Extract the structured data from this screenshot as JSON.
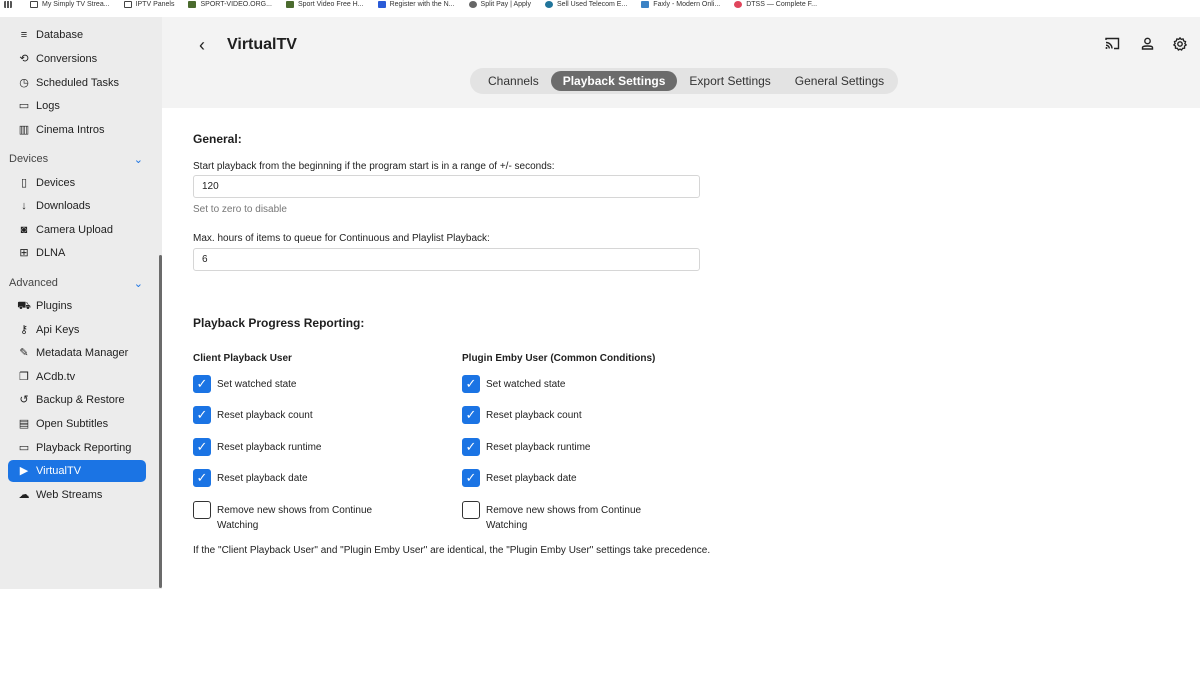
{
  "bookmarks": [
    {
      "label": "My Simply TV Strea...",
      "icon": "folder-icon"
    },
    {
      "label": "IPTV Panels",
      "icon": "folder-icon"
    },
    {
      "label": "SPORT-VIDEO.ORG...",
      "icon": "image-icon"
    },
    {
      "label": "Sport Video Free H...",
      "icon": "image-icon"
    },
    {
      "label": "Register with the N...",
      "icon": "blue-square-icon"
    },
    {
      "label": "Split Pay | Apply",
      "icon": "ball-icon"
    },
    {
      "label": "Sell Used Telecom E...",
      "icon": "wordpress-icon"
    },
    {
      "label": "Faxly - Modern Onli...",
      "icon": "fax-icon"
    },
    {
      "label": "DTSS — Complete F...",
      "icon": "red-dot-icon"
    }
  ],
  "sidebar": {
    "items_top": [
      {
        "label": "Database",
        "icon": "database-icon",
        "glyph": "≡"
      },
      {
        "label": "Conversions",
        "icon": "conversions-icon",
        "glyph": "⟲"
      },
      {
        "label": "Scheduled Tasks",
        "icon": "clock-icon",
        "glyph": "◷"
      },
      {
        "label": "Logs",
        "icon": "folder-open-icon",
        "glyph": "▭"
      },
      {
        "label": "Cinema Intros",
        "icon": "film-icon",
        "glyph": "▥"
      }
    ],
    "section_devices": "Devices",
    "items_devices": [
      {
        "label": "Devices",
        "icon": "devices-icon",
        "glyph": "▯"
      },
      {
        "label": "Downloads",
        "icon": "download-icon",
        "glyph": "↓"
      },
      {
        "label": "Camera Upload",
        "icon": "camera-icon",
        "glyph": "◙"
      },
      {
        "label": "DLNA",
        "icon": "dlna-icon",
        "glyph": "⊞"
      }
    ],
    "section_advanced": "Advanced",
    "items_advanced": [
      {
        "label": "Plugins",
        "icon": "cart-icon",
        "glyph": "⛟"
      },
      {
        "label": "Api Keys",
        "icon": "key-icon",
        "glyph": "⚷"
      },
      {
        "label": "Metadata Manager",
        "icon": "pencil-icon",
        "glyph": "✎"
      },
      {
        "label": "ACdb.tv",
        "icon": "copy-icon",
        "glyph": "❐"
      },
      {
        "label": "Backup & Restore",
        "icon": "restore-icon",
        "glyph": "↺"
      },
      {
        "label": "Open Subtitles",
        "icon": "subtitles-icon",
        "glyph": "▤"
      },
      {
        "label": "Playback Reporting",
        "icon": "folder-icon",
        "glyph": "▭"
      },
      {
        "label": "VirtualTV",
        "icon": "tv-icon",
        "glyph": "▶"
      },
      {
        "label": "Web Streams",
        "icon": "cloud-icon",
        "glyph": "☁"
      }
    ],
    "active": "VirtualTV"
  },
  "header": {
    "back_glyph": "‹",
    "title": "VirtualTV",
    "icons": [
      "cast-icon",
      "user-icon",
      "gear-icon"
    ]
  },
  "tabs": [
    "Channels",
    "Playback Settings",
    "Export Settings",
    "General Settings"
  ],
  "active_tab": "Playback Settings",
  "general": {
    "heading": "General:",
    "start_label": "Start playback from the beginning if the program start is in a range of +/- seconds:",
    "start_value": "120",
    "start_hint": "Set to zero to disable",
    "queue_label": "Max. hours of items to queue for Continuous and Playlist Playback:",
    "queue_value": "6"
  },
  "reporting": {
    "heading": "Playback Progress Reporting:",
    "client_heading": "Client Playback User",
    "plugin_heading": "Plugin Emby User (Common Conditions)",
    "client_options": [
      {
        "label": "Set watched state",
        "checked": true
      },
      {
        "label": "Reset playback count",
        "checked": true
      },
      {
        "label": "Reset playback runtime",
        "checked": true
      },
      {
        "label": "Reset playback date",
        "checked": true
      },
      {
        "label": "Remove new shows from Continue Watching",
        "checked": false
      }
    ],
    "plugin_options": [
      {
        "label": "Set watched state",
        "checked": true
      },
      {
        "label": "Reset playback count",
        "checked": true
      },
      {
        "label": "Reset playback runtime",
        "checked": true
      },
      {
        "label": "Reset playback date",
        "checked": true
      },
      {
        "label": "Remove new shows from Continue Watching",
        "checked": false
      }
    ],
    "note": "If the \"Client Playback User\" and \"Plugin Emby User\" are identical, the \"Plugin Emby User\" settings take precedence."
  },
  "colors": {
    "accent": "#1b74e4",
    "sidebar_bg": "#ececec",
    "header_bg": "#f3f3f3"
  }
}
